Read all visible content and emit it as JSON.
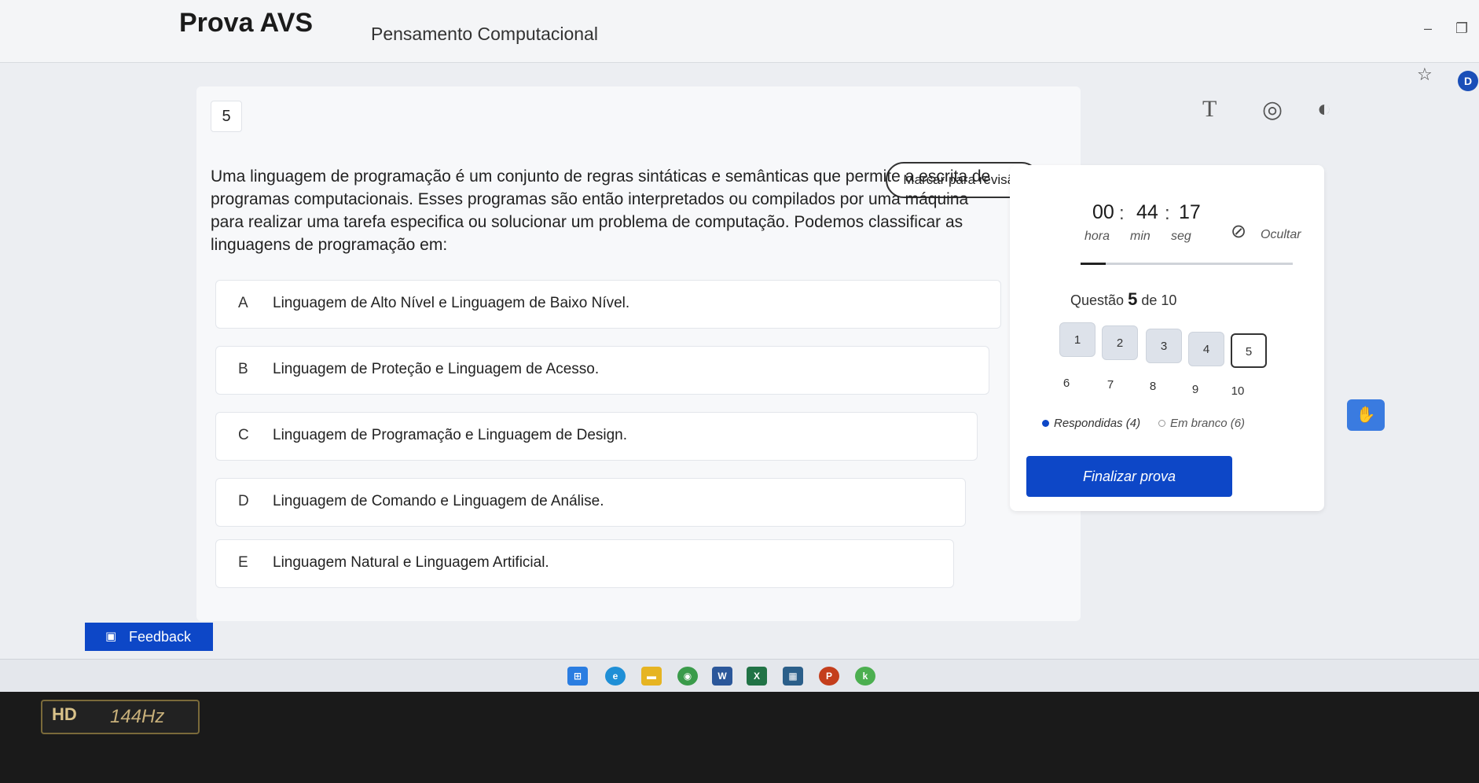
{
  "header": {
    "title": "Prova AVS",
    "course": "Pensamento Computacional"
  },
  "question": {
    "number": "5",
    "review_label": "Marcar para revisão",
    "stem": "Uma linguagem de programação é um conjunto de regras sintáticas e semânticas que permite a escrita de programas computacionais. Esses programas são então interpretados ou compilados por uma máquina para realizar uma tarefa especifica ou solucionar um problema de computação. Podemos classificar as linguagens de programação em:",
    "options": [
      {
        "letter": "A",
        "text": "Linguagem de Alto Nível e Linguagem de Baixo Nível."
      },
      {
        "letter": "B",
        "text": "Linguagem de Proteção e Linguagem de Acesso."
      },
      {
        "letter": "C",
        "text": "Linguagem de Programação e Linguagem de Design."
      },
      {
        "letter": "D",
        "text": "Linguagem de Comando e Linguagem de Análise."
      },
      {
        "letter": "E",
        "text": "Linguagem Natural e Linguagem Artificial."
      }
    ]
  },
  "timer": {
    "hours": "00",
    "minutes": "44",
    "seconds": "17",
    "hours_label": "hora",
    "minutes_label": "min",
    "seconds_label": "seg",
    "hide_label": "Ocultar"
  },
  "progress": {
    "prefix": "Questão",
    "current": "5",
    "suffix": "de 10",
    "items": [
      "1",
      "2",
      "3",
      "4",
      "5",
      "6",
      "7",
      "8",
      "9",
      "10"
    ],
    "answered_label": "Respondidas (4)",
    "blank_label": "Em branco (6)",
    "finish_label": "Finalizar prova"
  },
  "feedback": {
    "label": "Feedback"
  },
  "bezel": {
    "hd": "HD",
    "rate": "144Hz"
  },
  "colors": {
    "primary": "#0d47c7",
    "answered": "#dde2ea"
  },
  "icons": {
    "text-size": "text-size-icon",
    "target": "target-icon",
    "contrast": "contrast-icon",
    "hide": "eye-off-icon",
    "star": "star-icon"
  }
}
